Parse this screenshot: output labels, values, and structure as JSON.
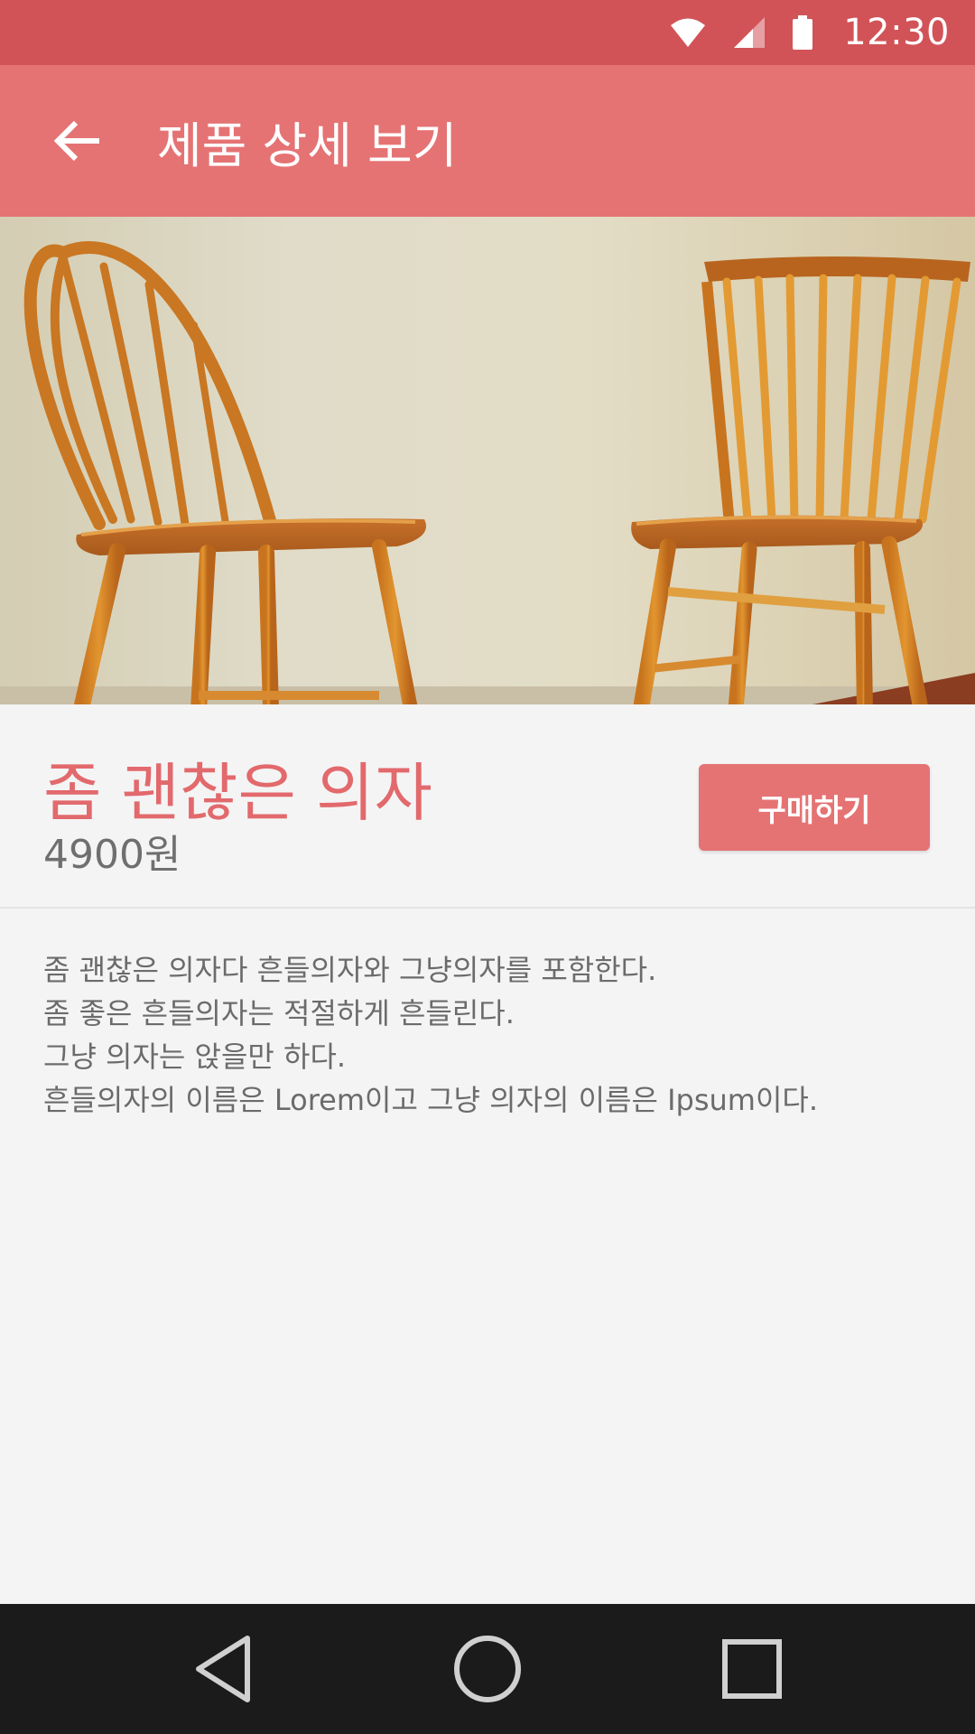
{
  "status_bar": {
    "time": "12:30",
    "icons": [
      "wifi-icon",
      "cellular-signal-icon",
      "battery-icon"
    ]
  },
  "app_bar": {
    "title": "제품 상세 보기",
    "back_icon": "arrow-back-icon"
  },
  "hero": {
    "image": "two-wooden-chairs-photo"
  },
  "product": {
    "name": "좀 괜찮은 의자",
    "price": "4900원",
    "buy_label": "구매하기"
  },
  "description": {
    "lines": [
      "좀 괜찮은 의자다 흔들의자와 그냥의자를 포함한다.",
      "좀 좋은 흔들의자는 적절하게 흔들린다.",
      "그냥 의자는 앉을만 하다.",
      "흔들의자의 이름은 Lorem이고 그냥 의자의 이름은 Ipsum이다."
    ]
  },
  "nav_bar": {
    "buttons": [
      "back-triangle-icon",
      "home-circle-icon",
      "recents-square-icon"
    ]
  },
  "colors": {
    "status_bar": "#d15358",
    "app_bar": "#e57374",
    "accent_text": "#e2696c",
    "background": "#f4f4f5",
    "nav_bar": "#1b1b1b"
  }
}
